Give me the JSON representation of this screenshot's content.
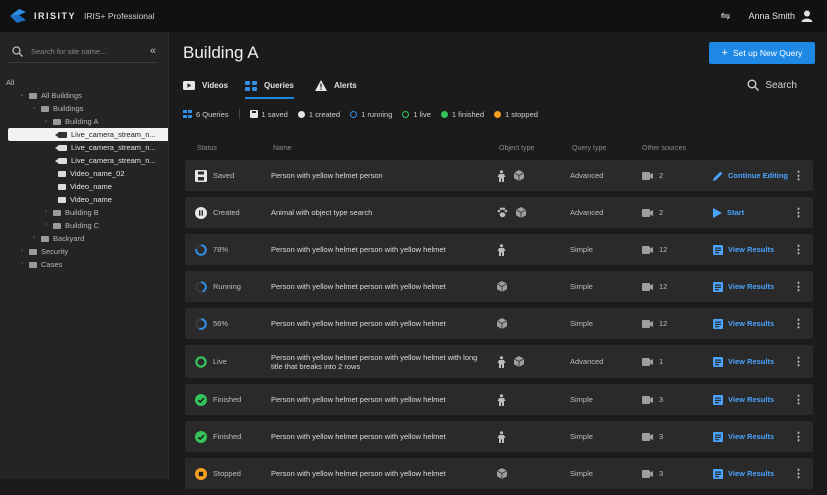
{
  "app": {
    "brand": "IRISITY",
    "product": "IRIS+ Professional",
    "user": "Anna Smith"
  },
  "sidebar": {
    "search_placeholder": "Search for site name...",
    "collapse_glyph": "«",
    "tree": [
      {
        "label": "All",
        "level": 0,
        "icon": "none",
        "chevron": ""
      },
      {
        "label": "All Buildings",
        "level": 1,
        "icon": "folder-icon",
        "chevron": "⌄"
      },
      {
        "label": "Buildings",
        "level": 2,
        "icon": "folder-icon",
        "chevron": "⌄"
      },
      {
        "label": "Building A",
        "level": 3,
        "icon": "folder-icon",
        "chevron": "⌄"
      },
      {
        "label": "Live_camera_stream_n...",
        "level": 4,
        "icon": "camera-icon",
        "chevron": "",
        "selected": true
      },
      {
        "label": "Live_camera_stream_n...",
        "level": 4,
        "icon": "camera-icon",
        "chevron": ""
      },
      {
        "label": "Live_camera_stream_n...",
        "level": 4,
        "icon": "camera-icon",
        "chevron": ""
      },
      {
        "label": "Video_name_02",
        "level": 4,
        "icon": "video-icon",
        "chevron": ""
      },
      {
        "label": "Video_name",
        "level": 4,
        "icon": "video-icon",
        "chevron": ""
      },
      {
        "label": "Video_name",
        "level": 4,
        "icon": "video-icon",
        "chevron": ""
      },
      {
        "label": "Building B",
        "level": 3,
        "icon": "folder-icon",
        "chevron": "›"
      },
      {
        "label": "Building C",
        "level": 3,
        "icon": "folder-icon",
        "chevron": "›"
      },
      {
        "label": "Backyard",
        "level": 2,
        "icon": "folder-icon",
        "chevron": "›"
      },
      {
        "label": "Security",
        "level": 1,
        "icon": "folder-icon",
        "chevron": "›"
      },
      {
        "label": "Cases",
        "level": 1,
        "icon": "folder-icon",
        "chevron": "›"
      }
    ]
  },
  "main": {
    "title": "Building A",
    "new_query_button": "Set up New Query",
    "tabs": [
      {
        "label": "Videos",
        "icon": "video-tab-icon",
        "active": false
      },
      {
        "label": "Queries",
        "icon": "queries-tab-icon",
        "active": true
      },
      {
        "label": "Alerts",
        "icon": "alert-tab-icon",
        "active": false
      }
    ],
    "search_label": "Search",
    "summary": {
      "total": "6 Queries",
      "saved": "1 saved",
      "created": "1 created",
      "running": "1 running",
      "live": "1 live",
      "finished": "1 finished",
      "stopped": "1 stopped"
    },
    "columns": {
      "status": "Status",
      "name": "Name",
      "object_type": "Object type",
      "query_type": "Query type",
      "other_sources": "Other sources"
    },
    "rows": [
      {
        "status": "Saved",
        "status_kind": "saved",
        "name": "Person with yellow helmet person",
        "objects": [
          "person",
          "object"
        ],
        "query_type": "Advanced",
        "sources": "2",
        "action": "Continue Editing",
        "action_kind": "edit"
      },
      {
        "status": "Created",
        "status_kind": "created",
        "name": "Animal with object type search",
        "objects": [
          "animal",
          "object"
        ],
        "query_type": "Advanced",
        "sources": "2",
        "action": "Start",
        "action_kind": "start"
      },
      {
        "status": "78%",
        "status_kind": "progress",
        "progress": 0.78,
        "name": "Person with yellow helmet person with yellow helmet",
        "objects": [
          "person"
        ],
        "query_type": "Simple",
        "sources": "12",
        "action": "View Results",
        "action_kind": "view"
      },
      {
        "status": "Running",
        "status_kind": "progress",
        "progress": 0.45,
        "name": "Person with yellow helmet person with yellow helmet",
        "objects": [
          "object"
        ],
        "query_type": "Simple",
        "sources": "12",
        "action": "View Results",
        "action_kind": "view"
      },
      {
        "status": "56%",
        "status_kind": "progress",
        "progress": 0.56,
        "name": "Person with yellow helmet person with yellow helmet",
        "objects": [
          "object"
        ],
        "query_type": "Simple",
        "sources": "12",
        "action": "View Results",
        "action_kind": "view"
      },
      {
        "status": "Live",
        "status_kind": "live",
        "name": "Person with yellow helmet person with yellow helmet with long title that breaks into 2 rows",
        "objects": [
          "person",
          "object"
        ],
        "query_type": "Advanced",
        "sources": "1",
        "action": "View Results",
        "action_kind": "view"
      },
      {
        "status": "Finished",
        "status_kind": "finished",
        "name": "Person with yellow helmet person with yellow helmet",
        "objects": [
          "person"
        ],
        "query_type": "Simple",
        "sources": "3",
        "action": "View Results",
        "action_kind": "view"
      },
      {
        "status": "Finished",
        "status_kind": "finished",
        "name": "Person with yellow helmet person with yellow helmet",
        "objects": [
          "person"
        ],
        "query_type": "Simple",
        "sources": "3",
        "action": "View Results",
        "action_kind": "view"
      },
      {
        "status": "Stopped",
        "status_kind": "stopped",
        "name": "Person with yellow helmet person with yellow helmet",
        "objects": [
          "object"
        ],
        "query_type": "Simple",
        "sources": "3",
        "action": "View Results",
        "action_kind": "view"
      }
    ]
  },
  "colors": {
    "accent": "#1e88e5",
    "link": "#4aa3ff",
    "running": "#2f8fe8",
    "live": "#35c45a",
    "finished": "#35c45a",
    "stopped": "#f5a020"
  }
}
